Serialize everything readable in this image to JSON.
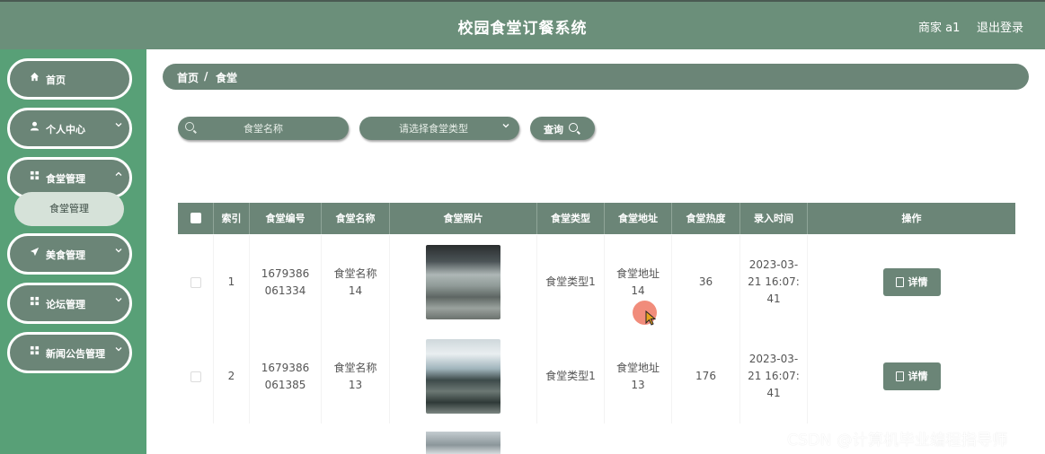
{
  "header": {
    "title": "校园食堂订餐系统",
    "user": "商家 a1",
    "logout": "退出登录"
  },
  "sidebar": {
    "items": [
      {
        "label": "首页",
        "icon": "home-icon",
        "has_chevron": false
      },
      {
        "label": "个人中心",
        "icon": "user-icon",
        "has_chevron": true
      },
      {
        "label": "食堂管理",
        "icon": "grid-icon",
        "has_chevron": true,
        "expanded": true
      },
      {
        "label": "美食管理",
        "icon": "send-icon",
        "has_chevron": true
      },
      {
        "label": "论坛管理",
        "icon": "grid-icon",
        "has_chevron": true
      },
      {
        "label": "新闻公告管理",
        "icon": "grid-icon",
        "has_chevron": true
      }
    ],
    "submenu": {
      "label": "食堂管理"
    }
  },
  "breadcrumb": {
    "home": "首页",
    "separator": "/",
    "current": "食堂"
  },
  "search": {
    "name_placeholder": "食堂名称",
    "type_placeholder": "请选择食堂类型",
    "query_label": "查询"
  },
  "table": {
    "columns": [
      "索引",
      "食堂编号",
      "食堂名称",
      "食堂照片",
      "食堂类型",
      "食堂地址",
      "食堂热度",
      "录入时间",
      "操作"
    ],
    "rows": [
      {
        "index": "1",
        "code": "1679386061334",
        "name": "食堂名称14",
        "type": "食堂类型1",
        "address": "食堂地址14",
        "heat": "36",
        "time": "2023-03-21 16:07:41",
        "action": "详情"
      },
      {
        "index": "2",
        "code": "1679386061385",
        "name": "食堂名称13",
        "type": "食堂类型1",
        "address": "食堂地址13",
        "heat": "176",
        "time": "2023-03-21 16:07:41",
        "action": "详情"
      }
    ]
  },
  "watermark": "CSDN @计算机毕业编程指导师",
  "colors": {
    "header": "#6b8f7a",
    "sidebar": "#58a077",
    "accent": "#6b8577",
    "submenu": "#d6e2d9"
  }
}
